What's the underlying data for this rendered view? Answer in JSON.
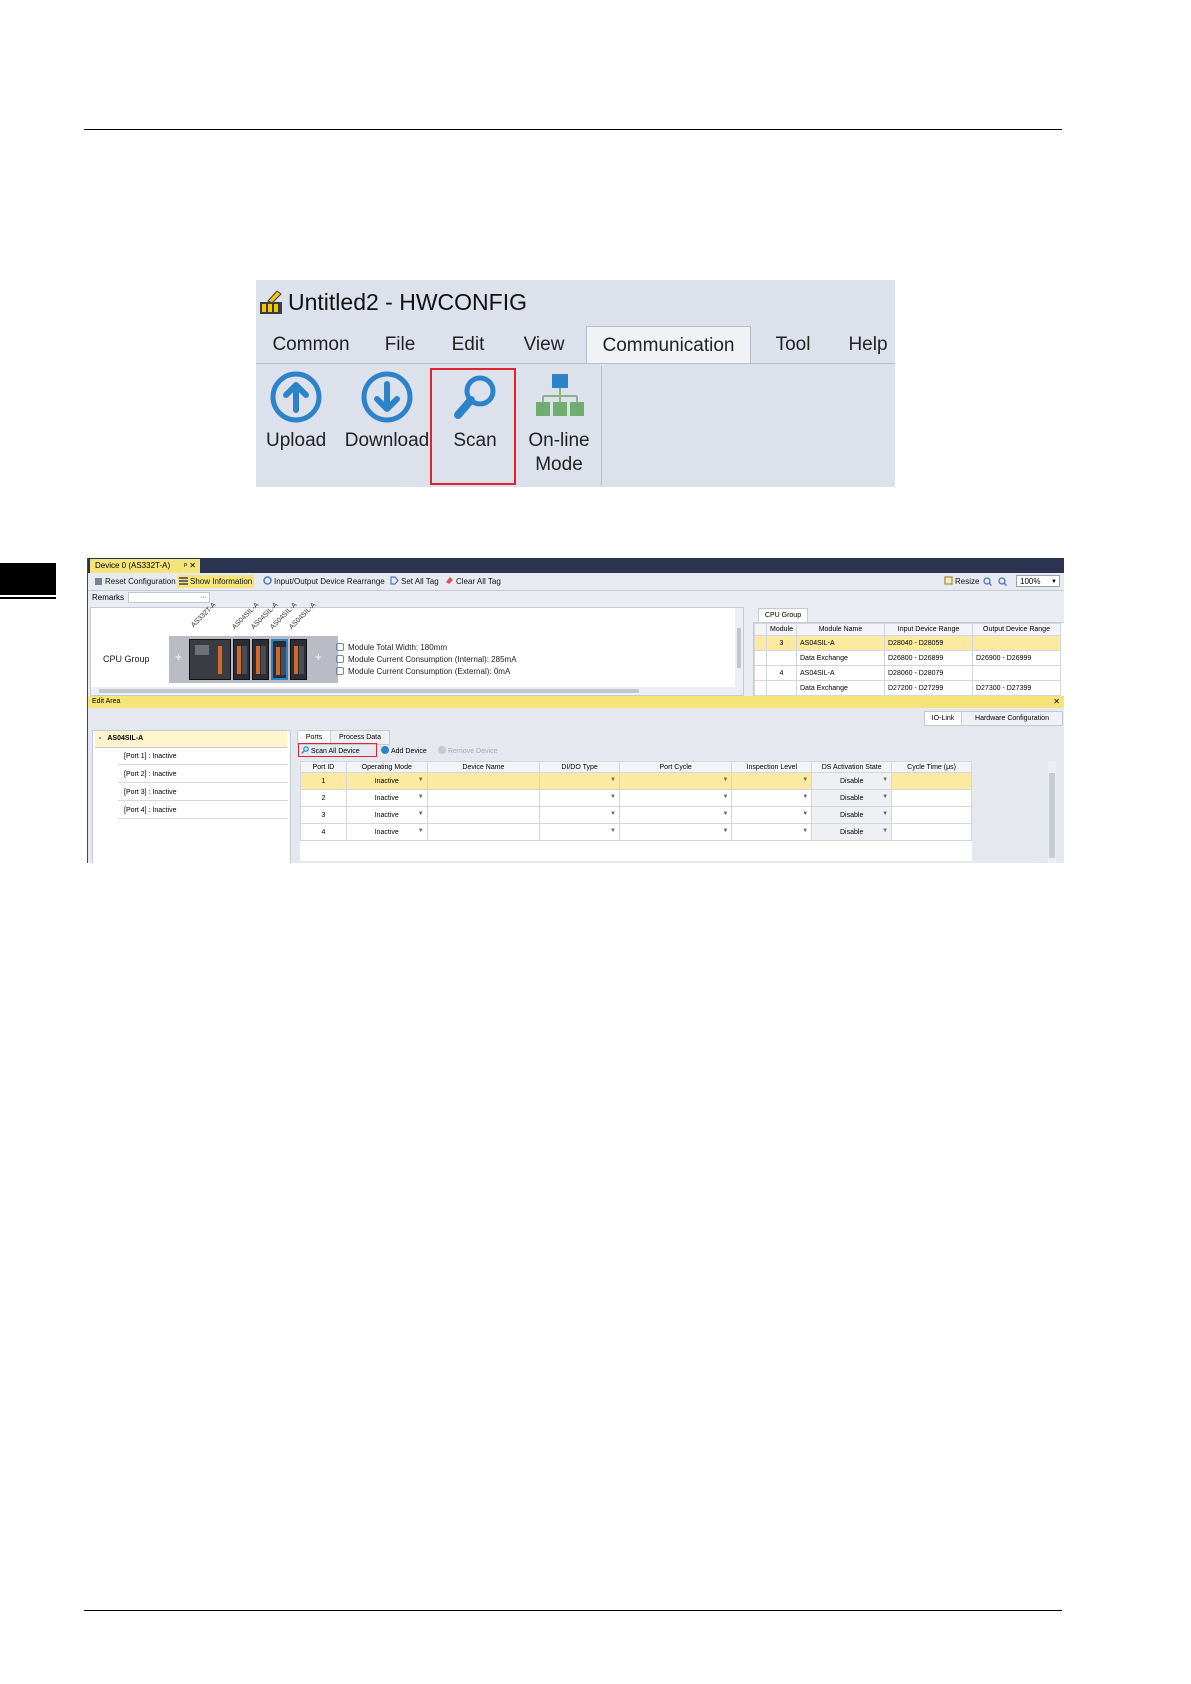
{
  "ribbon": {
    "title": "Untitled2 - HWCONFIG",
    "tabs": [
      "Common",
      "File",
      "Edit",
      "View",
      "Communication",
      "Tool",
      "Help"
    ],
    "active_tab": "Communication",
    "buttons": {
      "upload": "Upload",
      "download": "Download",
      "scan": "Scan",
      "online_line1": "On-line",
      "online_line2": "Mode"
    },
    "icons": [
      "upload-icon",
      "download-icon",
      "search-icon",
      "network-icon"
    ],
    "accent_color": "#2d83c9",
    "highlight_color": "#e0242f"
  },
  "hwconfig": {
    "doc_tab": "Device 0 (AS332T-A)",
    "doc_tab_pin": "ᵖ",
    "doc_tab_close": "✕",
    "toolbar": {
      "reset": "Reset Configuration",
      "show_info": "Show Information",
      "rearrange": "Input/Output Device Rearrange",
      "set_all_tag": "Set All Tag",
      "clear_all_tag": "Clear All Tag",
      "resize": "Resize",
      "zoom": "100%"
    },
    "remarks_label": "Remarks",
    "remarks_button": "···",
    "canvas": {
      "group_label": "CPU Group",
      "plus": "+",
      "module_labels": [
        "AS332T-A",
        "AS04SIL-A",
        "AS04SIL-A",
        "AS04SIL-A",
        "AS04SIL-A"
      ],
      "info": [
        "Module Total Width: 180mm",
        "Module Current Consumption (Internal): 285mA",
        "Module Current Consumption (External): 0mA"
      ]
    },
    "cpu_group": {
      "tab": "CPU Group",
      "headers": [
        "Module",
        "Module Name",
        "Input Device Range",
        "Output Device Range"
      ],
      "rows": [
        [
          "3",
          "AS04SIL-A",
          "D28040 - D28059",
          ""
        ],
        [
          "",
          "Data Exchange",
          "D26800 - D26899",
          "D26900 - D26999"
        ],
        [
          "4",
          "AS04SIL-A",
          "D28060 - D28079",
          ""
        ],
        [
          "",
          "Data Exchange",
          "D27200 - D27299",
          "D27300 - D27399"
        ]
      ]
    },
    "edit_area": {
      "title": "Edit Area",
      "close": "✕",
      "right_tabs": [
        "IO-Link",
        "Hardware Configuration"
      ],
      "tree_root": "AS04SIL-A",
      "tree_collapse": "-",
      "tree_items": [
        "[Port 1] : Inactive",
        "[Port 2] : Inactive",
        "[Port 3] : Inactive",
        "[Port 4] : Inactive"
      ],
      "port_tabs": [
        "Ports",
        "Process Data"
      ],
      "port_toolbar": {
        "scan_all": "Scan All Device",
        "add": "Add Device",
        "remove": "Remove Device"
      },
      "grid_headers": [
        "Port ID",
        "Operating Mode",
        "Device Name",
        "DI/DO Type",
        "Port Cycle",
        "Inspection Level",
        "DS Activation State",
        "Cycle Time (μs)"
      ],
      "grid_rows": [
        [
          "1",
          "Inactive",
          "",
          "",
          "",
          "",
          "Disable",
          ""
        ],
        [
          "2",
          "Inactive",
          "",
          "",
          "",
          "",
          "Disable",
          ""
        ],
        [
          "3",
          "Inactive",
          "",
          "",
          "",
          "",
          "Disable",
          ""
        ],
        [
          "4",
          "Inactive",
          "",
          "",
          "",
          "",
          "Disable",
          ""
        ]
      ]
    },
    "selection_color": "#f4e47a"
  }
}
